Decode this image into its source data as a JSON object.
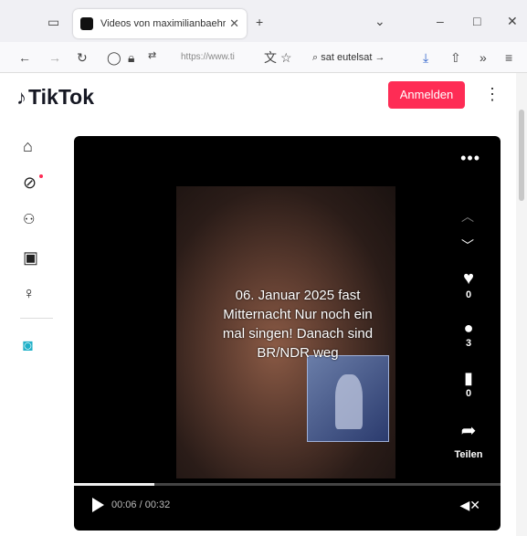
{
  "browser": {
    "tab_title": "Videos von maximilianbaehring",
    "tab_close": "✕",
    "new_tab": "+",
    "url": "https://www.ti",
    "search_text": "sat eutelsat"
  },
  "header": {
    "logo_text": "TikTok",
    "login_label": "Anmelden"
  },
  "video": {
    "caption": "06. Januar 2025 fast Mitternacht Nur noch ein mal singen!  Danach sind BR/NDR weg",
    "likes": "0",
    "comments": "3",
    "saves": "0",
    "share_label": "Teilen",
    "time": "00:06 / 00:32",
    "progress": 0.1875
  },
  "icons": {
    "sidebar": [
      "home-icon",
      "explore-icon",
      "following-icon",
      "live-icon",
      "profile-icon",
      "avatar-icon"
    ],
    "player": [
      "more-icon",
      "heart-icon",
      "comment-icon",
      "bookmark-icon",
      "share-icon",
      "play-icon",
      "mute-icon"
    ]
  },
  "colors": {
    "accent": "#fe2c55",
    "player_bg": "#000000"
  }
}
